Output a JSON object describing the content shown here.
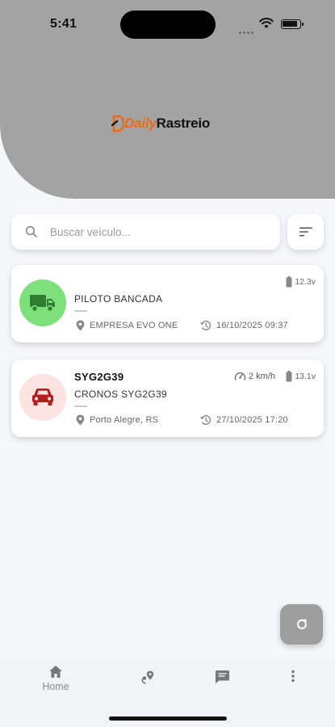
{
  "status_bar": {
    "time": "5:41"
  },
  "brand": {
    "part1": "Daily",
    "part2": "Rastreio",
    "accent": "#ef6a18"
  },
  "search": {
    "placeholder": "Buscar veículo..."
  },
  "vehicles": [
    {
      "plate": "",
      "name": "PILOTO BANCADA",
      "location": "EMPRESA EVO ONE",
      "datetime": "16/10/2025 09:37",
      "voltage": "12.3v",
      "speed": "",
      "icon": "truck-icon",
      "status_color": "#7ee07b"
    },
    {
      "plate": "SYG2G39",
      "name": "CRONOS SYG2G39",
      "location": "Porto Alegre, RS",
      "datetime": "27/10/2025 17:20",
      "voltage": "13.1v",
      "speed": "2 km/h",
      "icon": "car-icon",
      "status_color": "#fde2e2"
    }
  ],
  "nav": {
    "home_label": "Home"
  },
  "colors": {
    "header_gray": "#a3a3a3",
    "truck_green": "#2e7d32",
    "car_red": "#b71c1c"
  }
}
